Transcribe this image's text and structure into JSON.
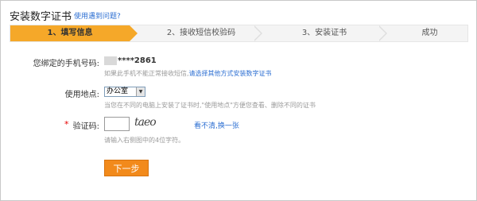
{
  "header": {
    "title": "安装数字证书",
    "help_link": "使用遇到问题?"
  },
  "steps": [
    {
      "label": "1、填写信息",
      "active": true
    },
    {
      "label": "2、接收短信校验码",
      "active": false
    },
    {
      "label": "3、安装证书",
      "active": false
    },
    {
      "label": "成功",
      "active": false
    }
  ],
  "form": {
    "phone_label": "您绑定的手机号码:",
    "phone_value": "****2861",
    "phone_hint_prefix": "如果此手机不能正常接收短信,",
    "phone_hint_link": "请选择其他方式安装数字证书",
    "location_label": "使用地点:",
    "location_value": "办公室",
    "location_hint": "当您在不同的电脑上安装了证书时,\"使用地点\"方便您查看、删除不同的证书",
    "captcha_required_mark": "*",
    "captcha_label": "验证码:",
    "captcha_input_value": "",
    "captcha_image_text": "taeo",
    "captcha_refresh_link": "看不清,换一张",
    "captcha_hint": "请输入右侧图中的4位字符。",
    "submit_label": "下一步"
  },
  "colors": {
    "active_step": "#f5a829",
    "submit": "#f28a1b",
    "link": "#2b6ed2",
    "required": "#e60000"
  }
}
